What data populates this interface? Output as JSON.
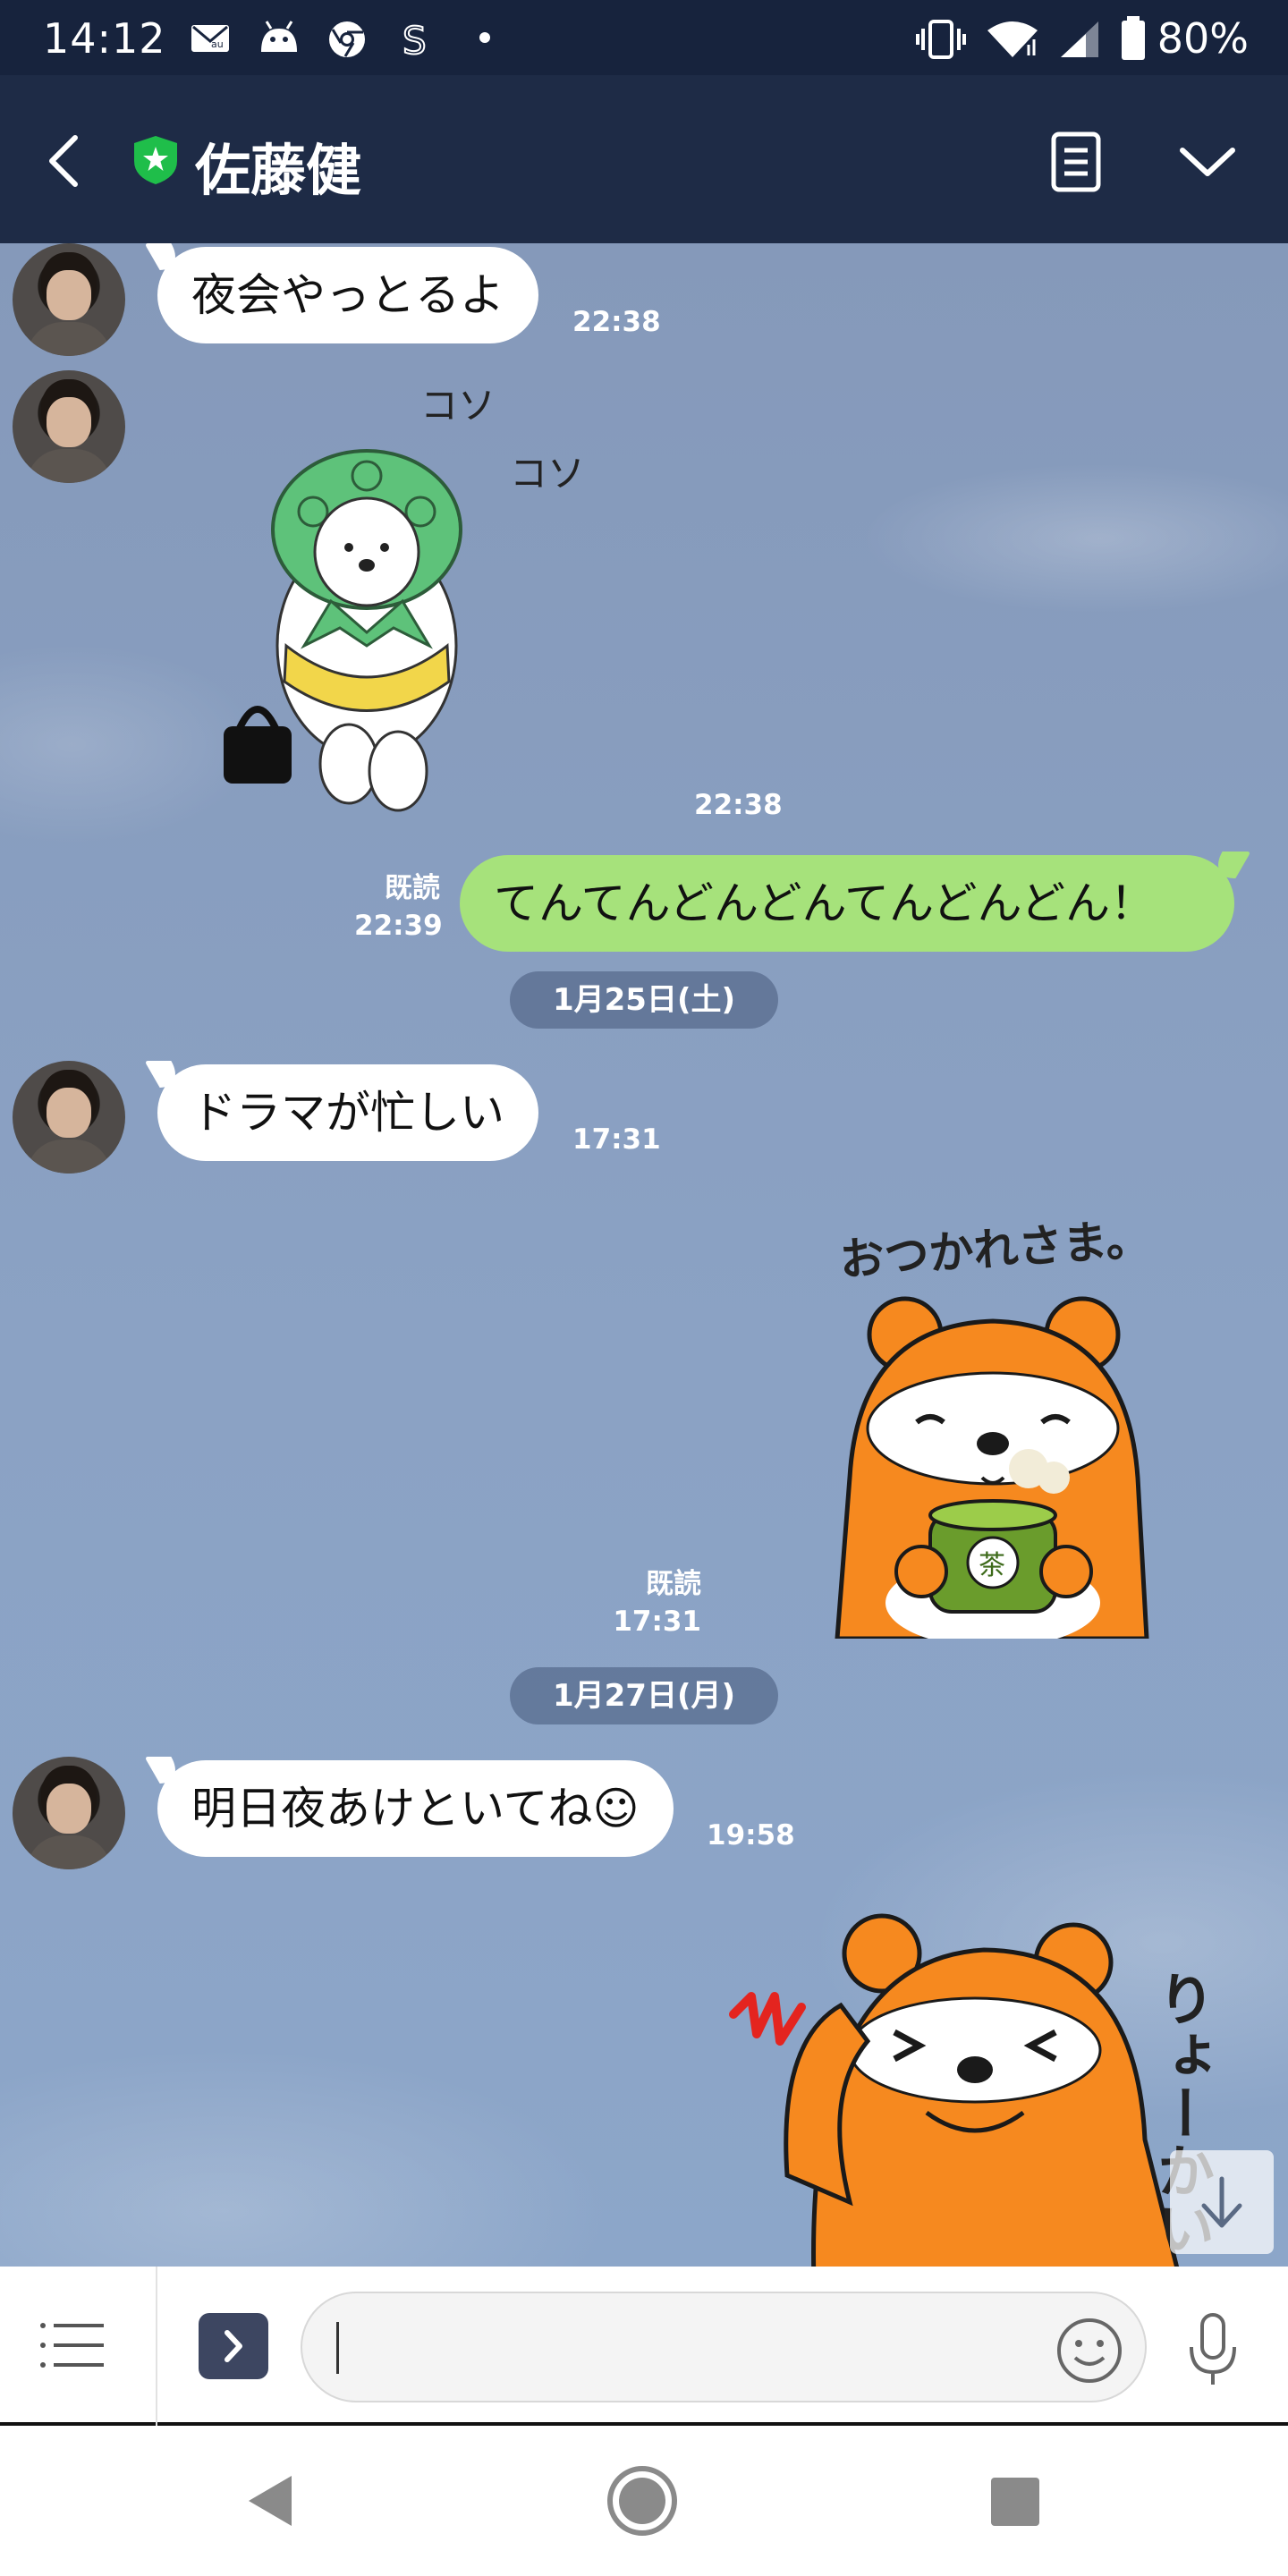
{
  "status_bar": {
    "time": "14:12",
    "battery": "80%",
    "notification_icons": [
      "mail-icon",
      "au-icon",
      "android-icon",
      "chrome-icon",
      "s-icon",
      "dot-icon"
    ],
    "system_icons": [
      "vibrate-icon",
      "wifi-icon",
      "signal-icon",
      "battery-icon"
    ]
  },
  "header": {
    "title": "佐藤健",
    "badge_icon": "shield-star-icon",
    "colors": {
      "bar": "#1e2b46",
      "badge": "#1fbe4a"
    }
  },
  "messages": [
    {
      "direction": "in",
      "kind": "text",
      "text": "夜会やっとるよ",
      "time": "22:38"
    },
    {
      "direction": "in",
      "kind": "sticker",
      "sticker": "dog-green-hood-sticker",
      "sticker_text": [
        "コソ",
        "コソ"
      ],
      "time": "22:38"
    },
    {
      "direction": "out",
      "kind": "text",
      "text": "てんてんどんどんてんどんどん！",
      "read": "既読",
      "time": "22:39"
    },
    {
      "kind": "date",
      "text": "1月25日(土)"
    },
    {
      "direction": "in",
      "kind": "text",
      "text": "ドラマが忙しい",
      "time": "17:31"
    },
    {
      "direction": "out",
      "kind": "sticker",
      "sticker": "bear-tea-sticker",
      "sticker_text": "おつかれさま。",
      "cup_text": "茶",
      "read": "既読",
      "time": "17:31"
    },
    {
      "kind": "date",
      "text": "1月27日(月)"
    },
    {
      "direction": "in",
      "kind": "text",
      "text": "明日夜あけといてね☺",
      "time": "19:58"
    },
    {
      "direction": "in",
      "kind": "sticker",
      "sticker": "bear-salute-sticker",
      "sticker_text": "りょーかい"
    }
  ],
  "input": {
    "placeholder": "",
    "value": "",
    "icons": [
      "list-menu-icon",
      "chevron-right-icon",
      "smiley-icon",
      "microphone-icon"
    ]
  },
  "colors": {
    "outgoing_bubble": "#a6e27b",
    "incoming_bubble": "#ffffff",
    "chat_background": "#8aa1c3",
    "sticker_bear": "#f6891f"
  }
}
